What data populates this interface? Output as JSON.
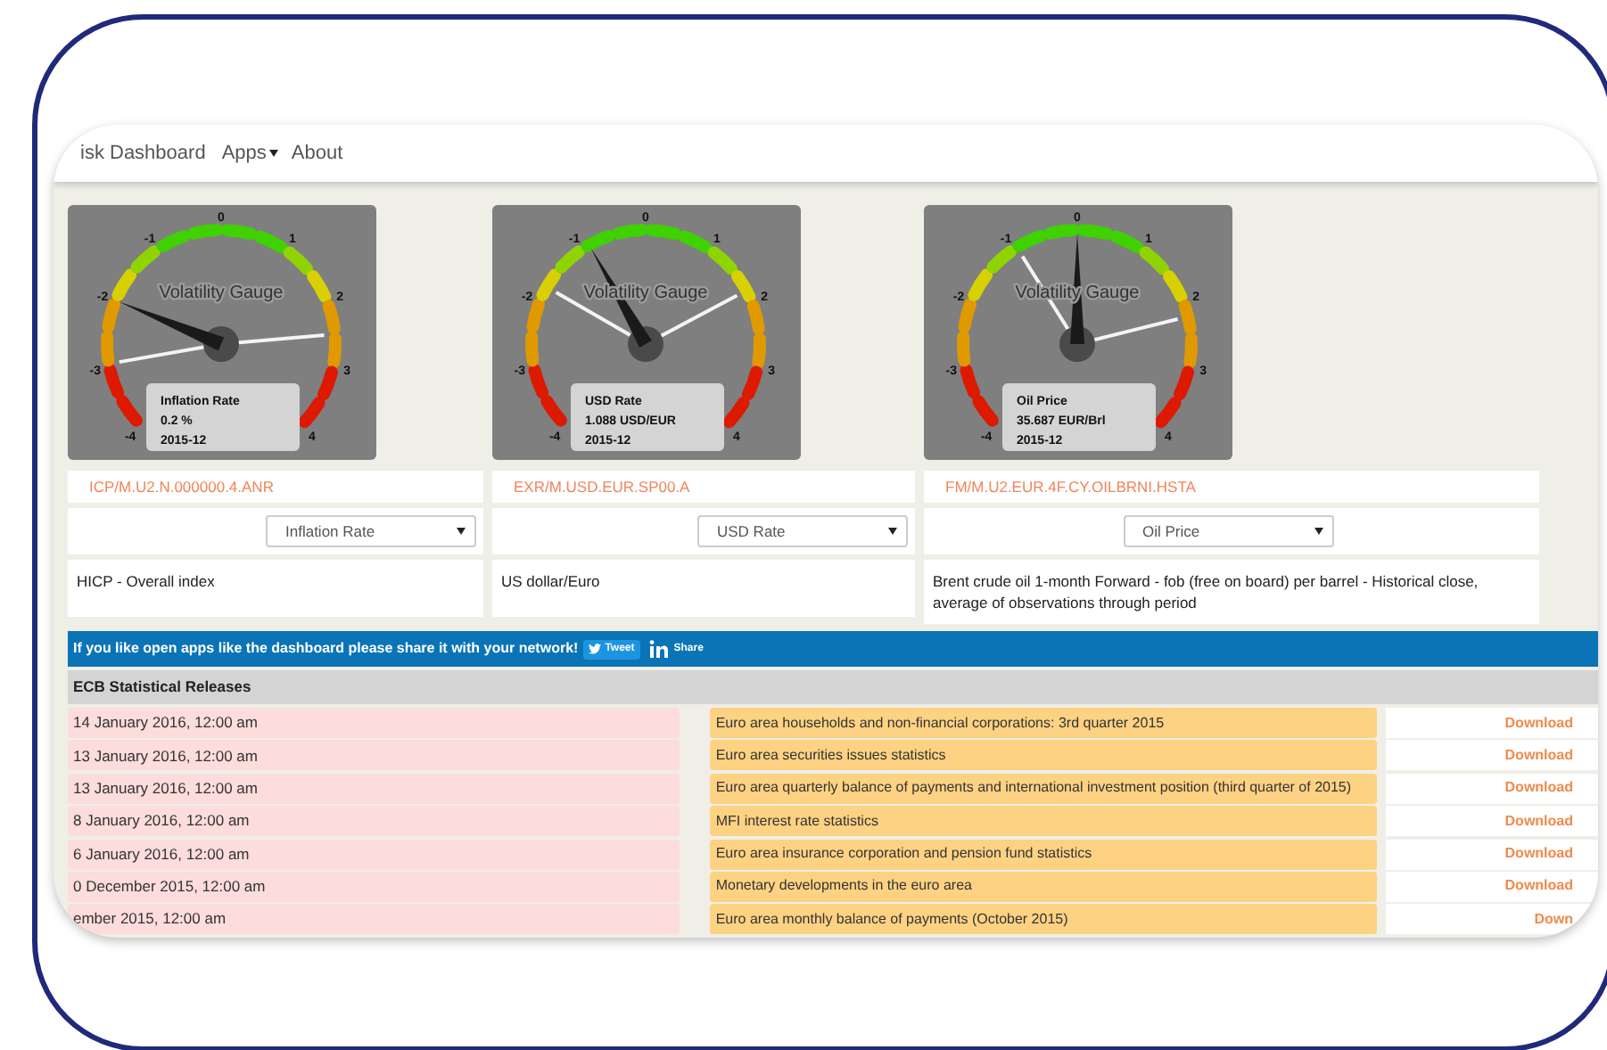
{
  "nav": {
    "brand": "isk Dashboard",
    "menu": [
      {
        "label": "Apps",
        "dropdown": true
      },
      {
        "label": "About",
        "dropdown": false
      }
    ]
  },
  "gauges": [
    {
      "title": "Volatility Gauge",
      "scale": [
        "-4",
        "-3",
        "-2",
        "-1",
        "0",
        "1",
        "2",
        "3",
        "4"
      ],
      "name": "Inflation Rate",
      "value": "0.2 %",
      "date": "2015-12",
      "level": 0.25,
      "series_code": "ICP/M.U2.N.000000.4.ANR",
      "select": "Inflation Rate",
      "description": "HICP - Overall index"
    },
    {
      "title": "Volatility Gauge",
      "scale": [
        "-4",
        "-3",
        "-2",
        "-1",
        "0",
        "1",
        "2",
        "3",
        "4"
      ],
      "name": "USD Rate",
      "value": "1.088 USD/EUR",
      "date": "2015-12",
      "level": 0.39,
      "series_code": "EXR/M.USD.EUR.SP00.A",
      "select": "USD Rate",
      "description": "US dollar/Euro"
    },
    {
      "title": "Volatility Gauge",
      "scale": [
        "-4",
        "-3",
        "-2",
        "-1",
        "0",
        "1",
        "2",
        "3",
        "4"
      ],
      "name": "Oil Price",
      "value": "35.687 EUR/Brl",
      "date": "2015-12",
      "level": 0.5,
      "series_code": "FM/M.U2.EUR.4F.CY.OILBRNI.HSTA",
      "select": "Oil Price",
      "description": "Brent crude oil 1-month Forward - fob (free on board) per barrel - Historical close, average of observations through period"
    }
  ],
  "banner": {
    "text": "If you like open apps like the dashboard please share it with your network!",
    "tweet": "Tweet",
    "share": "Share"
  },
  "releases": {
    "title": "ECB Statistical Releases",
    "rows": [
      {
        "date": "14 January 2016, 12:00 am",
        "title": "Euro area households and non-financial corporations: 3rd quarter 2015",
        "link": "Download"
      },
      {
        "date": "13 January 2016, 12:00 am",
        "title": "Euro area securities issues statistics",
        "link": "Download"
      },
      {
        "date": "13 January 2016, 12:00 am",
        "title": "Euro area quarterly balance of payments and international investment position (third quarter of 2015)",
        "link": "Download"
      },
      {
        "date": "8 January 2016, 12:00 am",
        "title": "MFI interest rate statistics",
        "link": "Download"
      },
      {
        "date": "6 January 2016, 12:00 am",
        "title": "Euro area insurance corporation and pension fund statistics",
        "link": "Download"
      },
      {
        "date": "0 December 2015, 12:00 am",
        "title": "Monetary developments in the euro area",
        "link": "Download"
      },
      {
        "date": "ember 2015, 12:00 am",
        "title": "Euro area monthly balance of payments (October 2015)",
        "link": "Down"
      }
    ]
  }
}
